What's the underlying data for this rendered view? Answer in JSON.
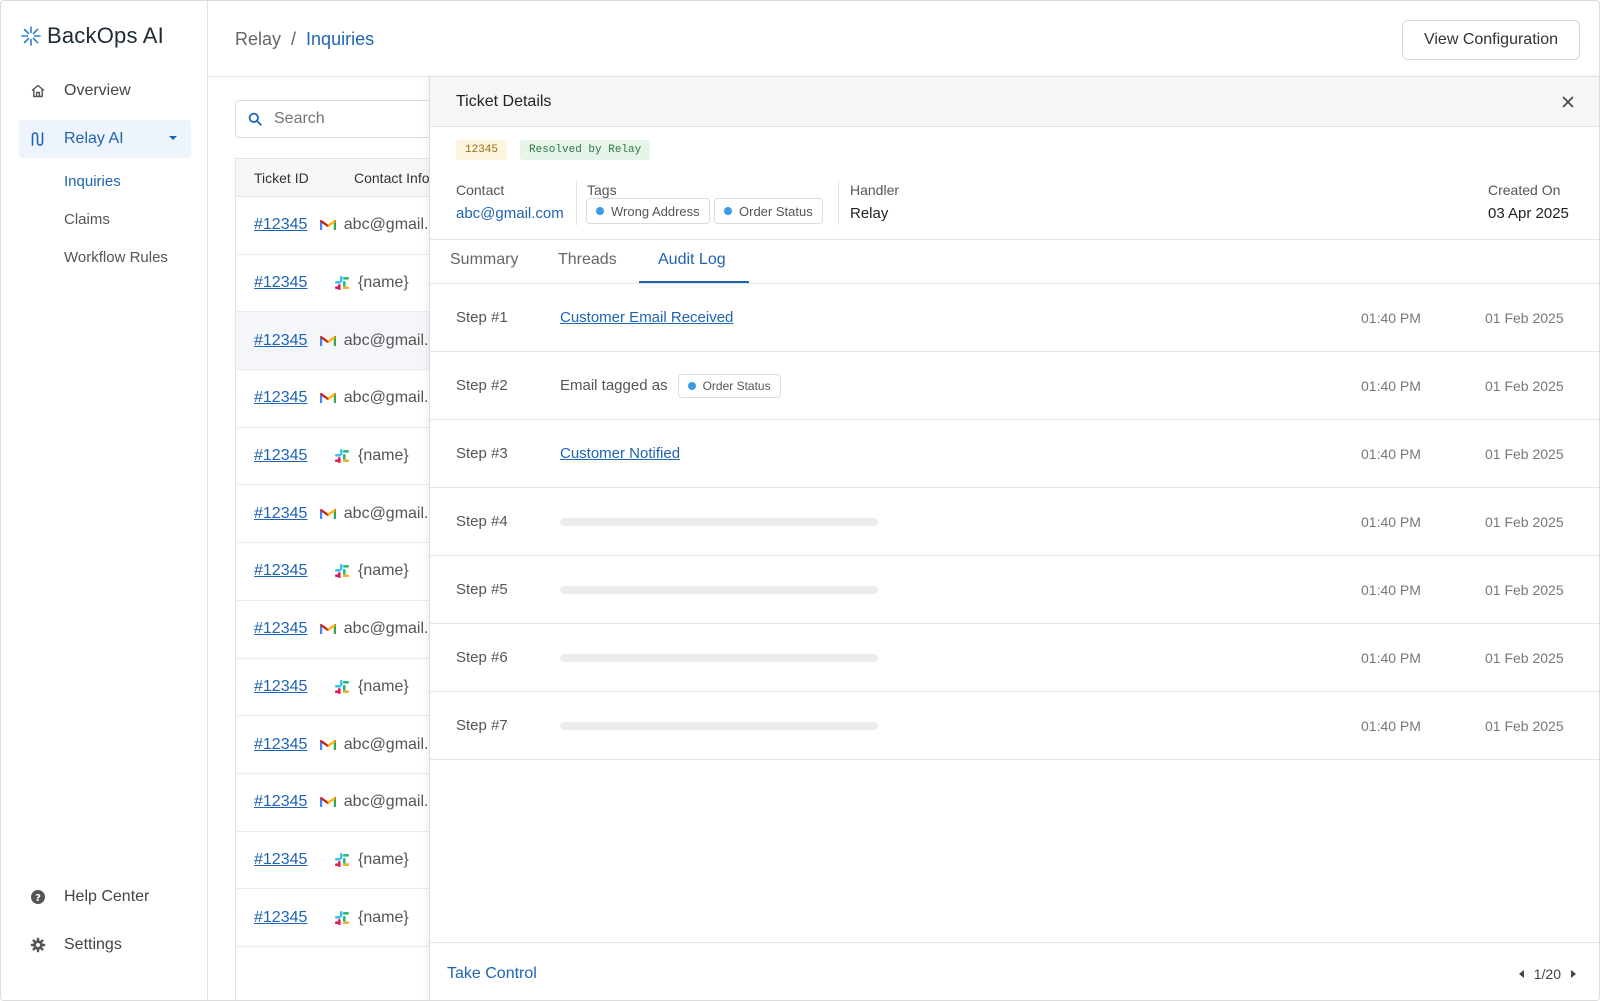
{
  "app": {
    "name": "BackOps AI"
  },
  "sidebar": {
    "items": [
      {
        "label": "Overview",
        "icon": "home-icon"
      },
      {
        "label": "Relay AI",
        "icon": "relay-icon"
      }
    ],
    "sub_items": [
      {
        "label": "Inquiries"
      },
      {
        "label": "Claims"
      },
      {
        "label": "Workflow Rules"
      }
    ],
    "bottom": [
      {
        "label": "Help Center",
        "icon": "help-icon"
      },
      {
        "label": "Settings",
        "icon": "gear-icon"
      }
    ]
  },
  "header": {
    "breadcrumb_root": "Relay",
    "breadcrumb_sep": "/",
    "breadcrumb_current": "Inquiries",
    "config_button": "View Configuration"
  },
  "search": {
    "placeholder": "Search"
  },
  "table": {
    "columns": [
      "Ticket ID",
      "Contact Info"
    ],
    "rows": [
      {
        "id": "#12345",
        "source": "gmail",
        "contact": "abc@gmail.com"
      },
      {
        "id": "#12345",
        "source": "slack",
        "contact": "{name}"
      },
      {
        "id": "#12345",
        "source": "gmail",
        "contact": "abc@gmail.com"
      },
      {
        "id": "#12345",
        "source": "gmail",
        "contact": "abc@gmail.com"
      },
      {
        "id": "#12345",
        "source": "slack",
        "contact": "{name}"
      },
      {
        "id": "#12345",
        "source": "gmail",
        "contact": "abc@gmail.com"
      },
      {
        "id": "#12345",
        "source": "slack",
        "contact": "{name}"
      },
      {
        "id": "#12345",
        "source": "gmail",
        "contact": "abc@gmail.com"
      },
      {
        "id": "#12345",
        "source": "slack",
        "contact": "{name}"
      },
      {
        "id": "#12345",
        "source": "gmail",
        "contact": "abc@gmail.com"
      },
      {
        "id": "#12345",
        "source": "gmail",
        "contact": "abc@gmail.com"
      },
      {
        "id": "#12345",
        "source": "slack",
        "contact": "{name}"
      },
      {
        "id": "#12345",
        "source": "slack",
        "contact": "{name}"
      }
    ]
  },
  "panel": {
    "title": "Ticket Details",
    "ticket_id": "12345",
    "status": "Resolved by Relay",
    "contact_label": "Contact",
    "contact_value": "abc@gmail.com",
    "tags_label": "Tags",
    "tags": [
      "Wrong Address",
      "Order Status"
    ],
    "handler_label": "Handler",
    "handler_value": "Relay",
    "created_label": "Created On",
    "created_value": "03 Apr 2025",
    "tabs": [
      "Summary",
      "Threads",
      "Audit Log"
    ],
    "steps": [
      {
        "num": "Step #1",
        "type": "link",
        "text": "Customer Email Received",
        "time": "01:40 PM",
        "date": "01 Feb 2025"
      },
      {
        "num": "Step #2",
        "type": "tag",
        "text": "Email tagged as",
        "tag": "Order Status",
        "time": "01:40 PM",
        "date": "01 Feb 2025"
      },
      {
        "num": "Step #3",
        "type": "link",
        "text": "Customer Notified",
        "time": "01:40 PM",
        "date": "01 Feb 2025"
      },
      {
        "num": "Step #4",
        "type": "loading",
        "time": "01:40 PM",
        "date": "01 Feb 2025"
      },
      {
        "num": "Step #5",
        "type": "loading",
        "time": "01:40 PM",
        "date": "01 Feb 2025"
      },
      {
        "num": "Step #6",
        "type": "loading",
        "time": "01:40 PM",
        "date": "01 Feb 2025"
      },
      {
        "num": "Step #7",
        "type": "loading",
        "time": "01:40 PM",
        "date": "01 Feb 2025"
      }
    ],
    "footer": {
      "take_control": "Take Control",
      "pager": "1/20"
    }
  },
  "colors": {
    "accent": "#1f63b3",
    "tag_dot": "#3f9ae6"
  }
}
